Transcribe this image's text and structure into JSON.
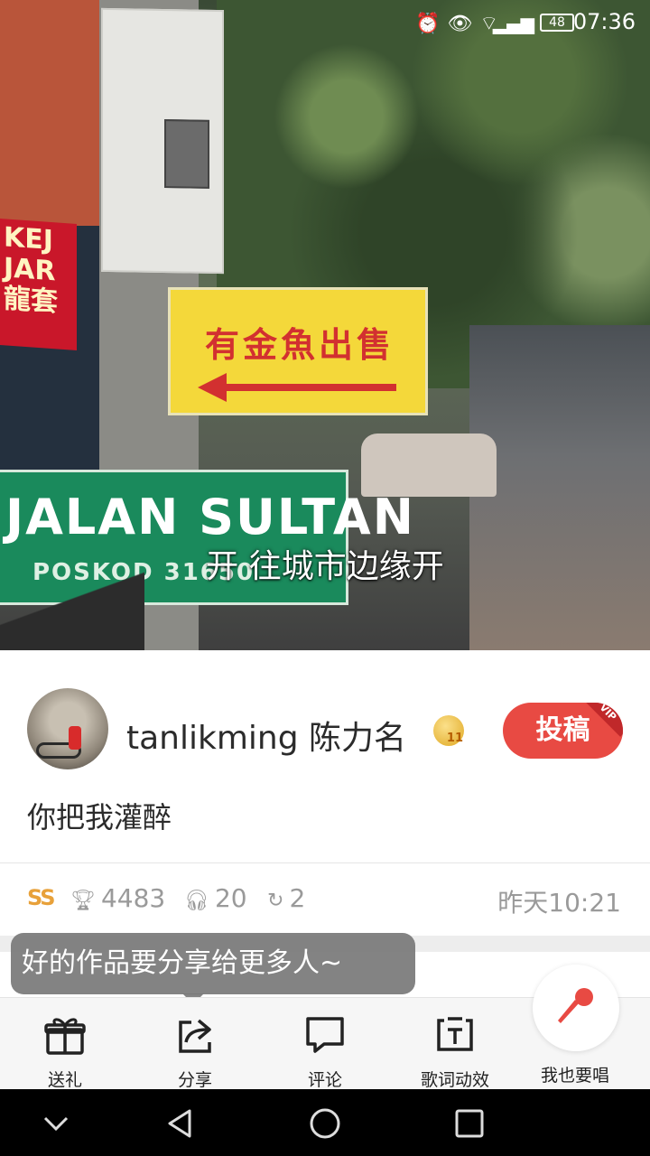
{
  "status_bar": {
    "battery": "48",
    "time": "07:36",
    "icons": [
      "alarm-icon",
      "eye-icon",
      "wifi-icon",
      "signal-icon",
      "battery-icon"
    ]
  },
  "media": {
    "sign_yellow_text": "有金魚出售",
    "street_sign_name": "JALAN SULTAN",
    "street_sign_postcode": "POSKOD 31650",
    "banner_text": "KEJ JAR 龍套",
    "lyric": "开 往城市边缘开"
  },
  "post": {
    "username": "tanlikming 陈力名",
    "level": "11",
    "submit_label": "投稿",
    "vip_label": "VIP",
    "caption": "你把我灌醉"
  },
  "stats": {
    "ss_label": "SS",
    "trophy_count": "4483",
    "listen_count": "20",
    "share_count": "2",
    "time": "昨天10:21"
  },
  "tooltip": {
    "text": "好的作品要分享给更多人~"
  },
  "actions": [
    {
      "label": "送礼",
      "icon": "gift-icon"
    },
    {
      "label": "分享",
      "icon": "share-icon"
    },
    {
      "label": "评论",
      "icon": "comment-icon"
    },
    {
      "label": "歌词动效",
      "icon": "lyrics-effect-icon"
    },
    {
      "label": "我也要唱",
      "icon": "microphone-icon"
    }
  ],
  "colors": {
    "accent": "#e84a43",
    "secondary_text": "#9a9a9a",
    "ss_badge": "#e8a13a"
  }
}
